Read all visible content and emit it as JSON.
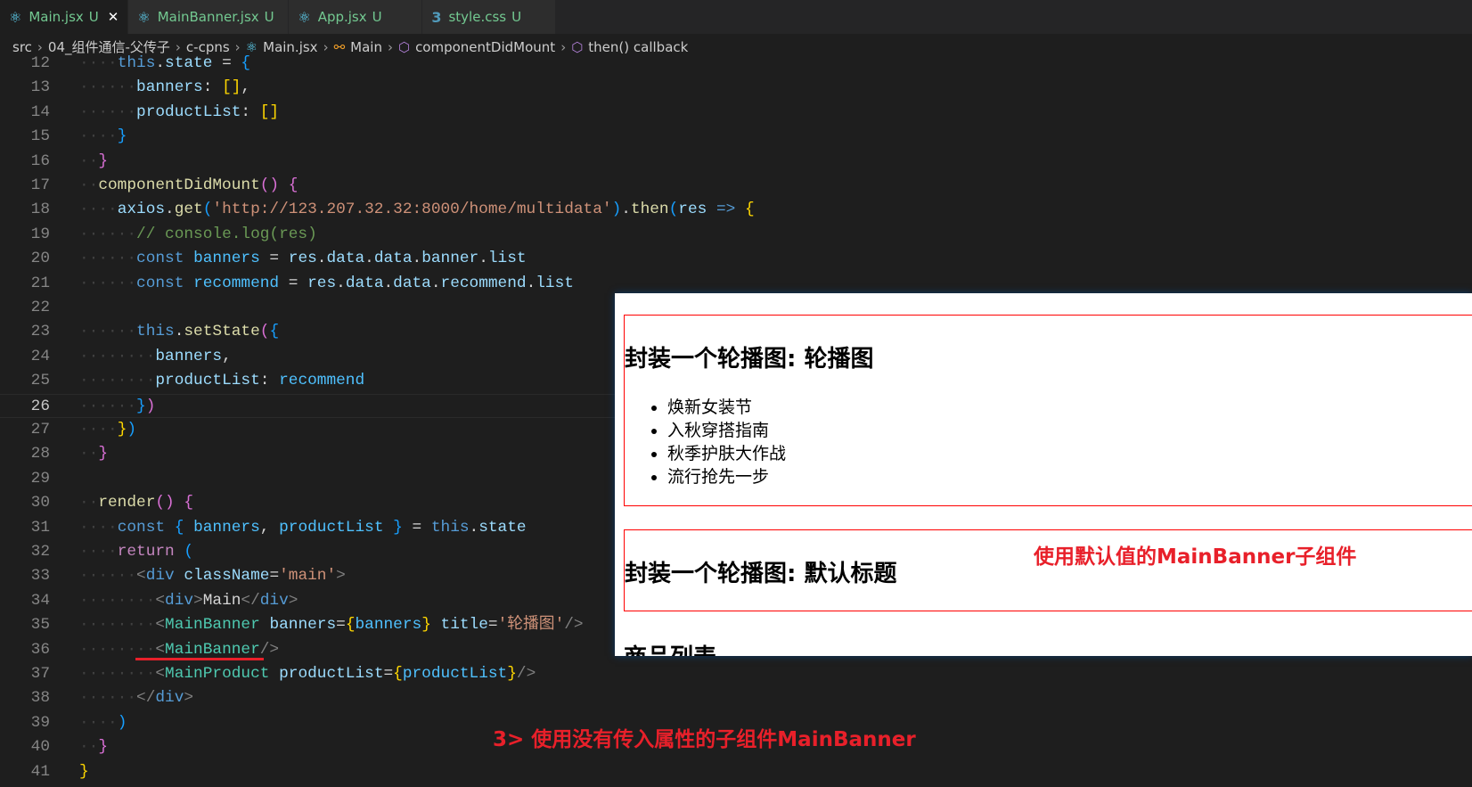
{
  "tabs": [
    {
      "label": "Main.jsx",
      "status": "U",
      "icon": "react-icon",
      "active": true
    },
    {
      "label": "MainBanner.jsx",
      "status": "U",
      "icon": "react-icon"
    },
    {
      "label": "App.jsx",
      "status": "U",
      "icon": "react-icon"
    },
    {
      "label": "style.css",
      "status": "U",
      "icon": "css-icon"
    }
  ],
  "breadcrumb": [
    "src",
    "04_组件通信-父传子",
    "c-cpns",
    "Main.jsx",
    "Main",
    "componentDidMount",
    "then() callback"
  ],
  "code": [
    {
      "n": "12",
      "i": 2,
      "t": [
        [
          "this",
          "k"
        ],
        [
          ".",
          "p"
        ],
        [
          "state",
          "v"
        ],
        [
          " = ",
          "p"
        ],
        [
          "{",
          "b3"
        ]
      ]
    },
    {
      "n": "13",
      "i": 3,
      "t": [
        [
          "banners",
          "v"
        ],
        [
          ": ",
          "p"
        ],
        [
          "[]",
          "b1"
        ],
        [
          ",",
          "p"
        ]
      ]
    },
    {
      "n": "14",
      "i": 3,
      "t": [
        [
          "productList",
          "v"
        ],
        [
          ": ",
          "p"
        ],
        [
          "[]",
          "b1"
        ]
      ]
    },
    {
      "n": "15",
      "i": 2,
      "t": [
        [
          "}",
          "b3"
        ]
      ]
    },
    {
      "n": "16",
      "i": 1,
      "t": [
        [
          "}",
          "b2"
        ]
      ]
    },
    {
      "n": "17",
      "i": 1,
      "t": [
        [
          "componentDidMount",
          "f"
        ],
        [
          "()",
          "b2"
        ],
        [
          " ",
          "p"
        ],
        [
          "{",
          "b2"
        ]
      ]
    },
    {
      "n": "18",
      "i": 2,
      "t": [
        [
          "axios",
          "v"
        ],
        [
          ".",
          "p"
        ],
        [
          "get",
          "f"
        ],
        [
          "(",
          "b3"
        ],
        [
          "'http://123.207.32.32:8000/home/multidata'",
          "s"
        ],
        [
          ")",
          "b3"
        ],
        [
          ".",
          "p"
        ],
        [
          "then",
          "f"
        ],
        [
          "(",
          "b3"
        ],
        [
          "res",
          "v"
        ],
        [
          " => ",
          "k"
        ],
        [
          "{",
          "b1"
        ]
      ]
    },
    {
      "n": "19",
      "i": 3,
      "t": [
        [
          "// console.log(res)",
          "c"
        ]
      ]
    },
    {
      "n": "20",
      "i": 3,
      "t": [
        [
          "const ",
          "k"
        ],
        [
          "banners",
          "cv"
        ],
        [
          " = ",
          "p"
        ],
        [
          "res",
          "v"
        ],
        [
          ".",
          "p"
        ],
        [
          "data",
          "v"
        ],
        [
          ".",
          "p"
        ],
        [
          "data",
          "v"
        ],
        [
          ".",
          "p"
        ],
        [
          "banner",
          "v"
        ],
        [
          ".",
          "p"
        ],
        [
          "list",
          "v"
        ]
      ]
    },
    {
      "n": "21",
      "i": 3,
      "t": [
        [
          "const ",
          "k"
        ],
        [
          "recommend",
          "cv"
        ],
        [
          " = ",
          "p"
        ],
        [
          "res",
          "v"
        ],
        [
          ".",
          "p"
        ],
        [
          "data",
          "v"
        ],
        [
          ".",
          "p"
        ],
        [
          "data",
          "v"
        ],
        [
          ".",
          "p"
        ],
        [
          "recommend",
          "v"
        ],
        [
          ".",
          "p"
        ],
        [
          "list",
          "v"
        ]
      ]
    },
    {
      "n": "22",
      "i": 0,
      "t": []
    },
    {
      "n": "23",
      "i": 3,
      "t": [
        [
          "this",
          "k"
        ],
        [
          ".",
          "p"
        ],
        [
          "setState",
          "f"
        ],
        [
          "(",
          "b2"
        ],
        [
          "{",
          "b3"
        ]
      ]
    },
    {
      "n": "24",
      "i": 4,
      "t": [
        [
          "banners",
          "v"
        ],
        [
          ",",
          "p"
        ]
      ]
    },
    {
      "n": "25",
      "i": 4,
      "t": [
        [
          "productList",
          "v"
        ],
        [
          ": ",
          "p"
        ],
        [
          "recommend",
          "cv"
        ]
      ]
    },
    {
      "n": "26",
      "i": 3,
      "t": [
        [
          "}",
          "b3"
        ],
        [
          ")",
          "b2"
        ]
      ],
      "current": true
    },
    {
      "n": "27",
      "i": 2,
      "t": [
        [
          "}",
          "b1"
        ],
        [
          ")",
          "b3"
        ]
      ]
    },
    {
      "n": "28",
      "i": 1,
      "t": [
        [
          "}",
          "b2"
        ]
      ]
    },
    {
      "n": "29",
      "i": 0,
      "t": []
    },
    {
      "n": "30",
      "i": 1,
      "t": [
        [
          "render",
          "f"
        ],
        [
          "()",
          "b2"
        ],
        [
          " ",
          "p"
        ],
        [
          "{",
          "b2"
        ]
      ]
    },
    {
      "n": "31",
      "i": 2,
      "t": [
        [
          "const ",
          "k"
        ],
        [
          "{ ",
          "b3"
        ],
        [
          "banners",
          "cv"
        ],
        [
          ", ",
          "p"
        ],
        [
          "productList",
          "cv"
        ],
        [
          " }",
          "b3"
        ],
        [
          " = ",
          "p"
        ],
        [
          "this",
          "k"
        ],
        [
          ".",
          "p"
        ],
        [
          "state",
          "v"
        ]
      ]
    },
    {
      "n": "32",
      "i": 2,
      "t": [
        [
          "return ",
          "ctl"
        ],
        [
          "(",
          "b3"
        ]
      ]
    },
    {
      "n": "33",
      "i": 3,
      "t": [
        [
          "<",
          "g"
        ],
        [
          "div",
          "k"
        ],
        [
          " ",
          "p"
        ],
        [
          "className",
          "v"
        ],
        [
          "=",
          "p"
        ],
        [
          "'main'",
          "s"
        ],
        [
          ">",
          "g"
        ]
      ]
    },
    {
      "n": "34",
      "i": 4,
      "t": [
        [
          "<",
          "g"
        ],
        [
          "div",
          "k"
        ],
        [
          ">",
          "g"
        ],
        [
          "Main",
          "p"
        ],
        [
          "</",
          "g"
        ],
        [
          "div",
          "k"
        ],
        [
          ">",
          "g"
        ]
      ]
    },
    {
      "n": "35",
      "i": 4,
      "t": [
        [
          "<",
          "g"
        ],
        [
          "MainBanner",
          "t"
        ],
        [
          " ",
          "p"
        ],
        [
          "banners",
          "v"
        ],
        [
          "=",
          "p"
        ],
        [
          "{",
          "b1"
        ],
        [
          "banners",
          "cv"
        ],
        [
          "}",
          "b1"
        ],
        [
          " ",
          "p"
        ],
        [
          "title",
          "v"
        ],
        [
          "=",
          "p"
        ],
        [
          "'轮播图'",
          "s"
        ],
        [
          "/>",
          "g"
        ]
      ]
    },
    {
      "n": "36",
      "i": 4,
      "t": [
        [
          "<",
          "g"
        ],
        [
          "MainBanner",
          "t"
        ],
        [
          "/>",
          "g"
        ]
      ]
    },
    {
      "n": "37",
      "i": 4,
      "t": [
        [
          "<",
          "g"
        ],
        [
          "MainProduct",
          "t"
        ],
        [
          " ",
          "p"
        ],
        [
          "productList",
          "v"
        ],
        [
          "=",
          "p"
        ],
        [
          "{",
          "b1"
        ],
        [
          "productList",
          "cv"
        ],
        [
          "}",
          "b1"
        ],
        [
          "/>",
          "g"
        ]
      ]
    },
    {
      "n": "38",
      "i": 3,
      "t": [
        [
          "</",
          "g"
        ],
        [
          "div",
          "k"
        ],
        [
          ">",
          "g"
        ]
      ]
    },
    {
      "n": "39",
      "i": 2,
      "t": [
        [
          ")",
          "b3"
        ]
      ]
    },
    {
      "n": "40",
      "i": 1,
      "t": [
        [
          "}",
          "b2"
        ]
      ]
    },
    {
      "n": "41",
      "i": 0,
      "t": [
        [
          "}",
          "b1"
        ]
      ]
    }
  ],
  "preview": {
    "banner1": {
      "title": "封装一个轮播图: 轮播图",
      "items": [
        "焕新女装节",
        "入秋穿搭指南",
        "秋季护肤大作战",
        "流行抢先一步"
      ]
    },
    "banner2": {
      "title": "封装一个轮播图: 默认标题"
    },
    "product_heading": "商品列表",
    "annotation": "使用默认值的MainBanner子组件"
  },
  "annotation_bottom": "3> 使用没有传入属性的子组件MainBanner",
  "colors": {
    "annotation": "#e8202a",
    "box_border": "#ff0000",
    "tab_modified": "#73c991"
  }
}
